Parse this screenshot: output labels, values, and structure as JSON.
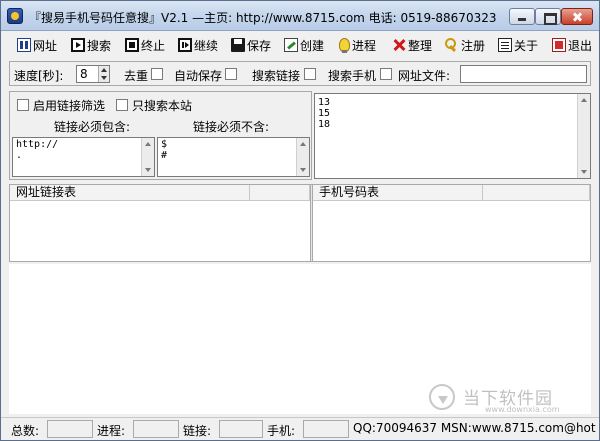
{
  "window": {
    "title": "『搜易手机号码任意搜』V2.1 —主页: http://www.8715.com 电话: 0519-88670323"
  },
  "toolbar": {
    "url": "网址",
    "search": "搜索",
    "stop": "终止",
    "resume": "继续",
    "save": "保存",
    "create": "创建",
    "process": "进程",
    "sort": "整理",
    "register": "注册",
    "about": "关于",
    "exit": "退出"
  },
  "options": {
    "speed_label": "速度[秒]:",
    "speed_value": "8",
    "dedupe": "去重",
    "autosave": "自动保存",
    "search_links": "搜索链接",
    "search_phones": "搜索手机",
    "url_file": "网址文件:",
    "url_file_value": ""
  },
  "filter": {
    "enable_link_filter": "启用链接筛选",
    "only_this_site": "只搜索本站",
    "must_contain_label": "链接必须包含:",
    "must_not_contain_label": "链接必须不含:",
    "must_contain_lines": [
      "http://",
      "."
    ],
    "must_not_contain_lines": [
      "$",
      "#"
    ]
  },
  "prefixes": [
    "13",
    "15",
    "18"
  ],
  "lists": {
    "url_list_header": "网址链接表",
    "phone_list_header": "手机号码表"
  },
  "watermark": {
    "brand_cn": "当下软件园",
    "brand_en": "www.downxia.com"
  },
  "status": {
    "total_label": "总数:",
    "process_label": "进程:",
    "link_label": "链接:",
    "phone_label": "手机:",
    "contact": "QQ:70094637 MSN:www.8715.com@hot"
  }
}
